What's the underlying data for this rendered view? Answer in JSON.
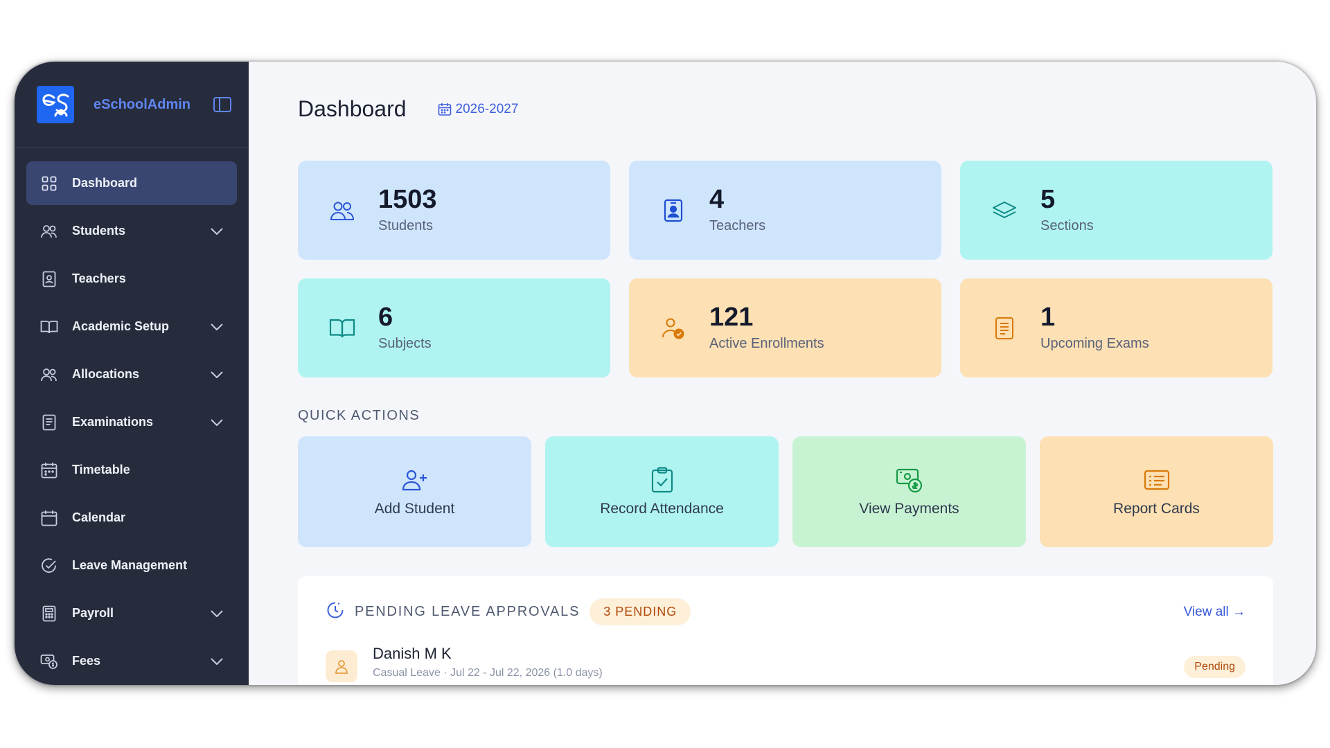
{
  "app": {
    "name": "eSchoolAdmin",
    "accent": "#1f66f0"
  },
  "sidebar": {
    "items": [
      {
        "label": "Dashboard",
        "icon": "grid-icon",
        "active": true,
        "expandable": false
      },
      {
        "label": "Students",
        "icon": "users-icon",
        "expandable": true
      },
      {
        "label": "Teachers",
        "icon": "id-badge-icon",
        "expandable": false
      },
      {
        "label": "Academic Setup",
        "icon": "book-open-icon",
        "expandable": true
      },
      {
        "label": "Allocations",
        "icon": "users-icon",
        "expandable": true
      },
      {
        "label": "Examinations",
        "icon": "document-icon",
        "expandable": true
      },
      {
        "label": "Timetable",
        "icon": "calendar-grid-icon",
        "expandable": false
      },
      {
        "label": "Calendar",
        "icon": "calendar-icon",
        "expandable": false
      },
      {
        "label": "Leave Management",
        "icon": "check-circle-icon",
        "expandable": false
      },
      {
        "label": "Payroll",
        "icon": "calculator-icon",
        "expandable": true
      },
      {
        "label": "Fees",
        "icon": "money-icon",
        "expandable": true
      }
    ]
  },
  "header": {
    "title": "Dashboard",
    "academic_year": "2026-2027"
  },
  "stats": [
    {
      "value": "1503",
      "label": "Students",
      "color": "#cfe5fc"
    },
    {
      "value": "4",
      "label": "Teachers",
      "color": "#cfe5fc"
    },
    {
      "value": "5",
      "label": "Sections",
      "color": "#b0f4f1"
    },
    {
      "value": "6",
      "label": "Subjects",
      "color": "#b0f4f1"
    },
    {
      "value": "121",
      "label": "Active Enrollments",
      "color": "#fde0b3"
    },
    {
      "value": "1",
      "label": "Upcoming Exams",
      "color": "#fde0b3"
    }
  ],
  "quick_actions": {
    "title": "QUICK ACTIONS",
    "items": [
      {
        "label": "Add Student",
        "icon": "user-plus-icon"
      },
      {
        "label": "Record Attendance",
        "icon": "clipboard-check-icon"
      },
      {
        "label": "View Payments",
        "icon": "money-icon"
      },
      {
        "label": "Report Cards",
        "icon": "list-card-icon"
      }
    ]
  },
  "leave_panel": {
    "title": "PENDING LEAVE APPROVALS",
    "badge": "3 PENDING",
    "view_all": "View all →",
    "rows": [
      {
        "name": "Danish M K",
        "detail": "Casual Leave · Jul 22 - Jul 22, 2026 (1.0 days)",
        "status": "Pending"
      }
    ]
  }
}
